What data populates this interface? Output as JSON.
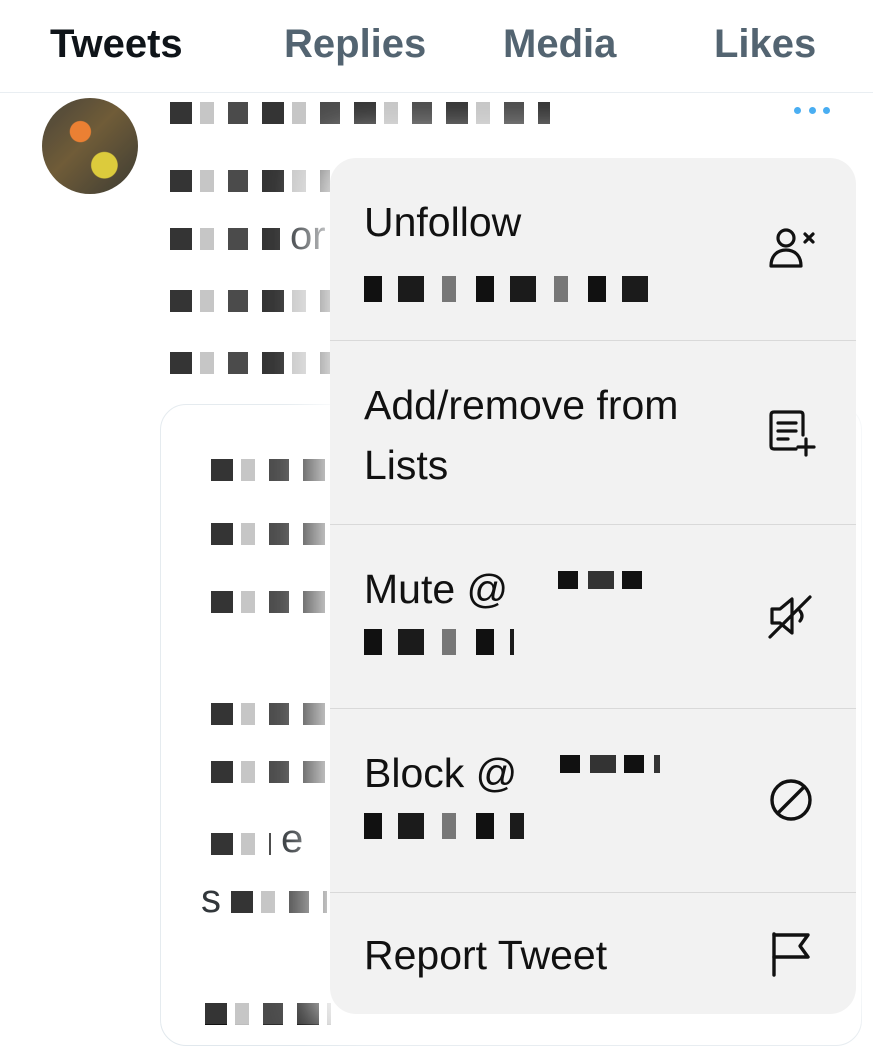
{
  "tabs": [
    {
      "label": "Tweets",
      "active": true
    },
    {
      "label": "Replies",
      "active": false
    },
    {
      "label": "Media",
      "active": false
    },
    {
      "label": "Likes",
      "active": false
    }
  ],
  "tweet": {
    "fragments": [
      "or",
      "e",
      "s"
    ]
  },
  "menu": {
    "items": [
      {
        "label": "Unfollow",
        "icon": "unfollow-icon"
      },
      {
        "label": "Add/remove from Lists",
        "icon": "add-to-list-icon"
      },
      {
        "label": "Mute @",
        "icon": "mute-icon"
      },
      {
        "label": "Block @",
        "icon": "block-icon"
      },
      {
        "label": "Report Tweet",
        "icon": "flag-icon"
      }
    ]
  },
  "colors": {
    "accent": "#1d9bf0",
    "menu_background": "#f2f2f2",
    "text": "#0f1419",
    "muted": "#536471"
  }
}
